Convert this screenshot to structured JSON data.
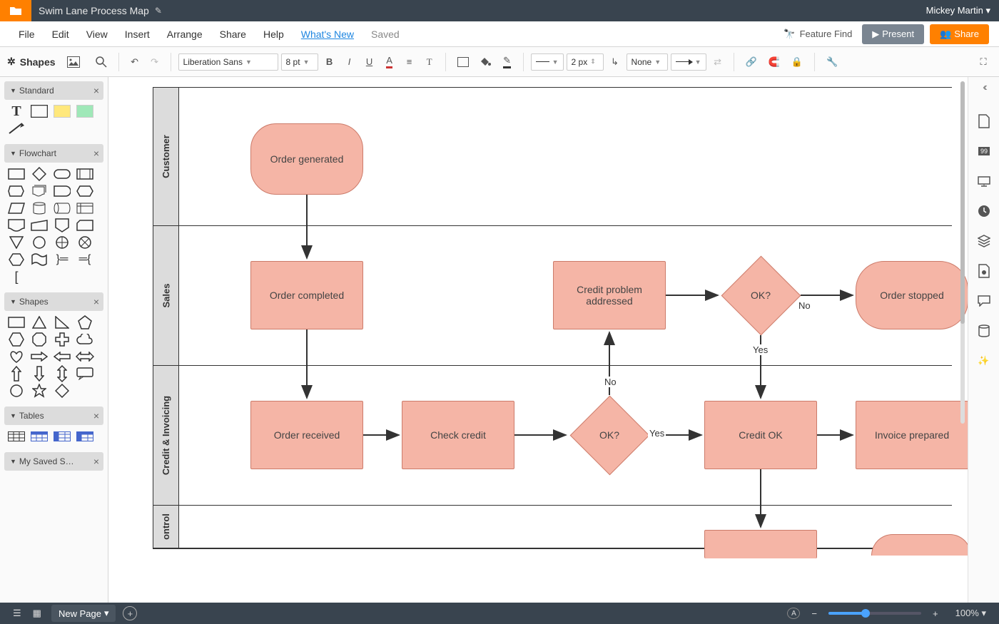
{
  "header": {
    "doc_title": "Swim Lane Process Map",
    "user_name": "Mickey Martin"
  },
  "menu": {
    "items": [
      "File",
      "Edit",
      "View",
      "Insert",
      "Arrange",
      "Share",
      "Help"
    ],
    "whats_new": "What's New",
    "saved": "Saved",
    "feature_find": "Feature Find",
    "present": "Present",
    "share": "Share"
  },
  "toolbar": {
    "shapes_label": "Shapes",
    "font_family": "Liberation Sans",
    "font_size": "8 pt",
    "line_width": "2 px",
    "line_end": "None"
  },
  "left_panel": {
    "sections": {
      "standard": "Standard",
      "flowchart": "Flowchart",
      "shapes": "Shapes",
      "tables": "Tables",
      "my_saved": "My Saved S…"
    }
  },
  "lanes": [
    {
      "id": "customer",
      "label": "Customer"
    },
    {
      "id": "sales",
      "label": "Sales"
    },
    {
      "id": "credit",
      "label": "Credit & Invoicing"
    },
    {
      "id": "control",
      "label": "ontrol"
    }
  ],
  "nodes": {
    "order_generated": "Order generated",
    "order_completed": "Order completed",
    "credit_problem": "Credit problem addressed",
    "ok1": "OK?",
    "order_stopped": "Order stopped",
    "order_received": "Order received",
    "check_credit": "Check credit",
    "ok2": "OK?",
    "credit_ok": "Credit OK",
    "invoice_prepared": "Invoice prepared"
  },
  "labels": {
    "no_top": "No",
    "yes_top": "Yes",
    "no_mid": "No",
    "yes_mid": "Yes"
  },
  "status_bar": {
    "page_selector": "New Page",
    "zoom_label": "100%"
  }
}
